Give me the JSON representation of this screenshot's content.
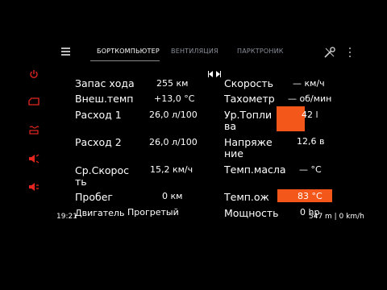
{
  "tabs": [
    {
      "label": "БОРТКОМПЬЮТЕР",
      "active": true
    },
    {
      "label": "ВЕНТИЛЯЦИЯ",
      "active": false
    },
    {
      "label": "ПАРКТРОНИК",
      "active": false
    }
  ],
  "icons": {
    "menu": "hamburger-menu-icon",
    "tools": "wrench-screwdriver-icon",
    "more": "kebab-menu-icon",
    "pager": "prev-next-icon",
    "side": [
      "power-icon",
      "car-door-icon",
      "seat-heater-icon",
      "speaker-icon",
      "volume-icon"
    ]
  },
  "accent_color": "#f4571a",
  "left_params": [
    {
      "label": "Запас хода",
      "value": "255 км"
    },
    {
      "label": "Внеш.темп",
      "value": "+13,0 °C"
    },
    {
      "label": "Расход 1",
      "value": "26,0 л/100"
    },
    {
      "label": "Расход 2",
      "value": "26,0 л/100"
    },
    {
      "label": "Ср.Скорость",
      "value": "15,2 км/ч"
    },
    {
      "label": "Пробег",
      "value": "0 км"
    },
    {
      "label": "Двигатель",
      "value": "Прогретый"
    }
  ],
  "right_params": [
    {
      "label": "Скорость",
      "value": "— км/ч"
    },
    {
      "label": "Тахометр",
      "value": "— об/мин"
    },
    {
      "label": "Ур.Топлива",
      "value": "42 l"
    },
    {
      "label": "Напряжение",
      "value": "12,6 в"
    },
    {
      "label": "Темп.масла",
      "value": "— °C"
    },
    {
      "label": "Темп.ож",
      "value": "83 °C"
    },
    {
      "label": "Мощность",
      "value": "0 hp"
    }
  ],
  "status": {
    "time": "19:21",
    "gps": "547 m | 0 km/h"
  }
}
